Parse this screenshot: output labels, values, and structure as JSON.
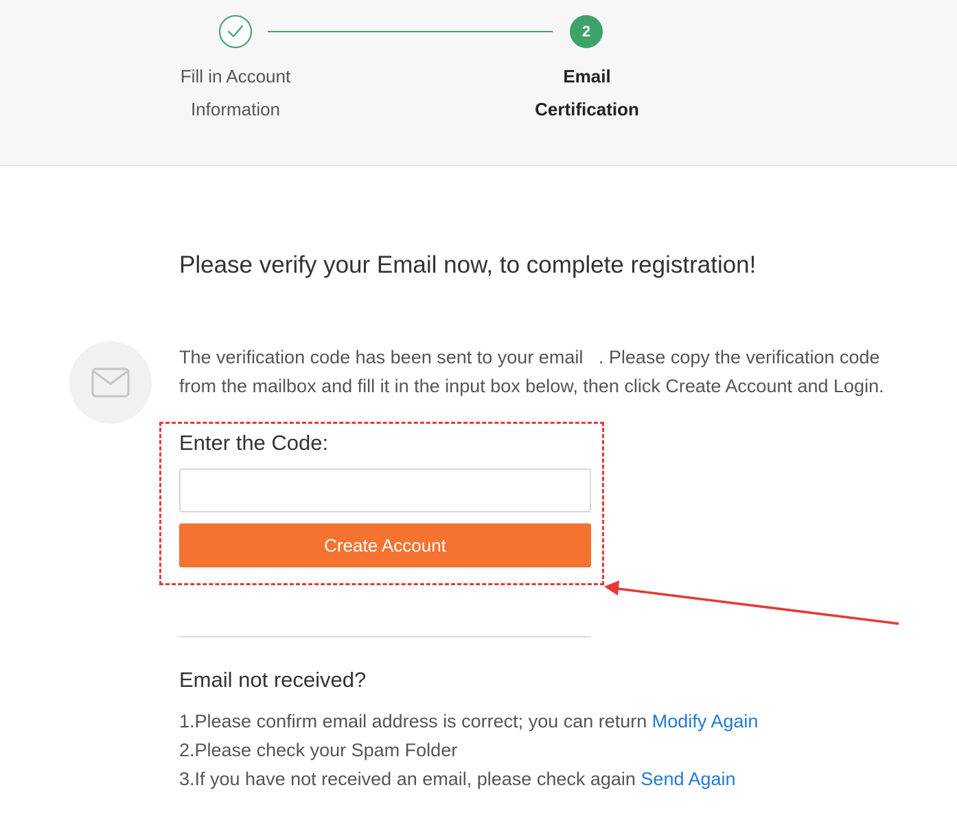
{
  "stepper": {
    "steps": [
      {
        "number": "1",
        "label_line1": "Fill in Account",
        "label_line2": "Information",
        "state": "completed"
      },
      {
        "number": "2",
        "label_line1": "Email",
        "label_line2": "Certification",
        "state": "active"
      }
    ]
  },
  "main": {
    "title": "Please verify your Email now, to complete registration!",
    "info_line1": "The verification code has been sent to your email   . Please copy the verification code",
    "info_line2": "from the mailbox and fill it in the input box below, then click Create Account and Login.",
    "code_label": "Enter the Code:",
    "code_value": "",
    "create_button": "Create Account"
  },
  "help": {
    "title": "Email not received?",
    "line1_text": "1.Please confirm email address is correct; you can return ",
    "line1_link": "Modify Again",
    "line2_text": "2.Please check your Spam Folder",
    "line3_text": "3.If you have not received an email, please check again ",
    "line3_link": "Send Again"
  },
  "colors": {
    "accent_green": "#3ea36a",
    "button_orange": "#f47330",
    "link_blue": "#1f7ad6",
    "annotation_red": "#e53935"
  },
  "icons": {
    "step1": "check-icon",
    "mail": "envelope-icon"
  }
}
